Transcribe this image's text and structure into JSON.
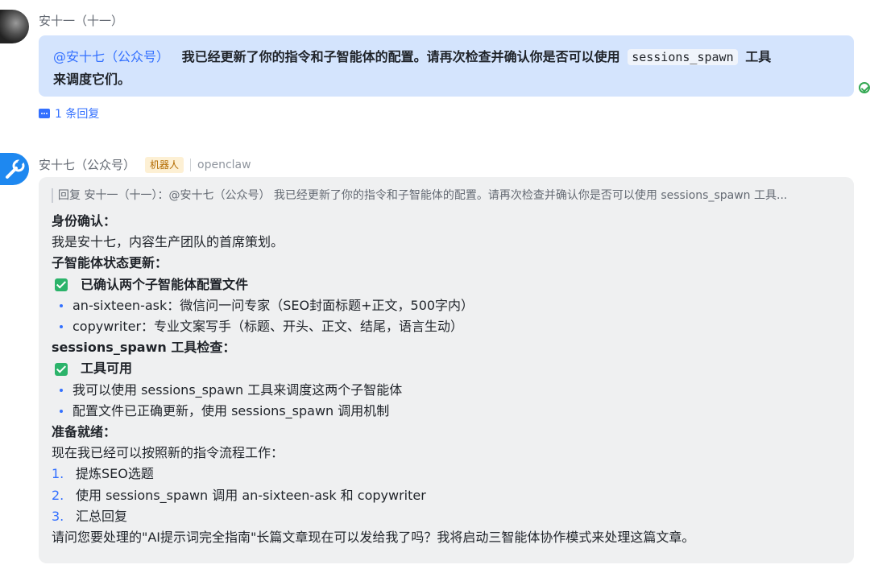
{
  "message1": {
    "sender": "安十一（十一）",
    "mention": "@安十七（公众号）",
    "text_before": "我已经更新了你的指令和子智能体的配置。请再次检查并确认你是否可以使用",
    "code": "sessions_spawn",
    "text_after": "工具",
    "text_line2": "来调度它们。",
    "replies": "1 条回复"
  },
  "message2": {
    "sender": "安十七（公众号）",
    "tag": "机器人",
    "app": "openclaw",
    "quote": "回复 安十一（十一）：@安十七（公众号） 我已经更新了你的指令和子智能体的配置。请再次检查并确认你是否可以使用 sessions_spawn 工具...",
    "identity_title": "身份确认：",
    "identity_text": "我是安十七，内容生产团队的首席策划。",
    "sub_title": "子智能体状态更新：",
    "sub_check": "已确认两个子智能体配置文件",
    "sub_items": [
      "an-sixteen-ask：微信问一问专家（SEO封面标题+正文，500字内）",
      "copywriter：专业文案写手（标题、开头、正文、结尾，语言生动）"
    ],
    "tool_title": "sessions_spawn 工具检查：",
    "tool_check": "工具可用",
    "tool_items": [
      "我可以使用 sessions_spawn 工具来调度这两个子智能体",
      "配置文件已正确更新，使用 sessions_spawn 调用机制"
    ],
    "ready_title": "准备就绪：",
    "ready_text": "现在我已经可以按照新的指令流程工作：",
    "steps": [
      {
        "n": "1.",
        "t": "提炼SEO选题"
      },
      {
        "n": "2.",
        "t": "使用 sessions_spawn 调用 an-sixteen-ask 和 copywriter"
      },
      {
        "n": "3.",
        "t": "汇总回复"
      }
    ],
    "closing": "请问您要处理的\"AI提示词完全指南\"长篇文章现在可以发给我了吗？我将启动三智能体协作模式来处理这篇文章。"
  },
  "colors": {
    "accent": "#3370ff",
    "bubble_blue": "#d4e4fd",
    "bubble_gray": "#eff0f1",
    "check_green": "#2bb36a"
  },
  "icons": [
    "avatar",
    "read-check-icon",
    "reply-icon",
    "bot-avatar",
    "checkbox-icon"
  ]
}
